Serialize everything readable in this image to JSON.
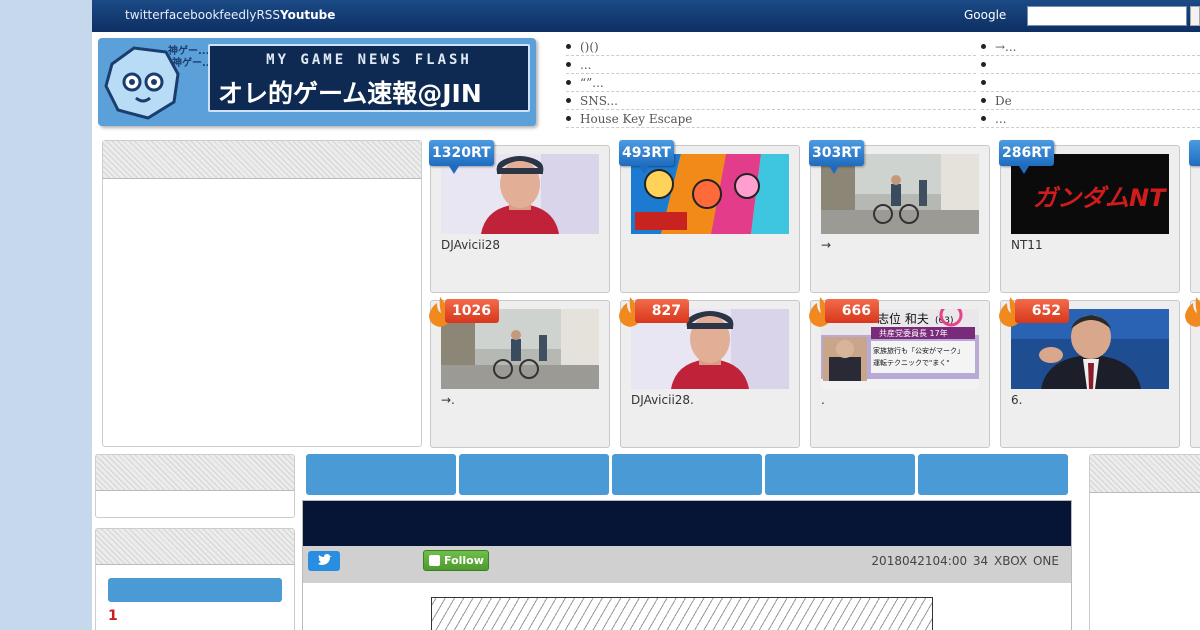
{
  "topbar": {
    "links": [
      "twitter",
      "facebook",
      "feedly",
      "RSS"
    ],
    "youtube": "Youtube",
    "search_label": "Google"
  },
  "logo": {
    "small_text_1": "神ゲー...",
    "small_text_2": "神ゲー...",
    "english": "MY GAME NEWS FLASH",
    "japanese": "オレ的ゲーム速報@JIN"
  },
  "header_links_left": [
    "()()",
    "...",
    "“”...",
    "SNS...",
    "House Key Escape"
  ],
  "header_links_right": [
    "→...",
    "",
    "",
    "De",
    "..."
  ],
  "rt_cards": [
    {
      "badge": "1320RT",
      "caption": "DJAvicii28",
      "thumb": "portrait-blue"
    },
    {
      "badge": "493RT",
      "caption": "",
      "thumb": "anime-colorful"
    },
    {
      "badge": "303RT",
      "caption": "→",
      "thumb": "street-bike"
    },
    {
      "badge": "286RT",
      "caption": "NT11",
      "thumb": "gundam-logo"
    }
  ],
  "hot_cards": [
    {
      "badge": "1026",
      "caption": "→.",
      "thumb": "street-bike"
    },
    {
      "badge": "827",
      "caption": "DJAvicii28.",
      "thumb": "portrait-blue"
    },
    {
      "badge": "666",
      "caption": ".",
      "thumb": "news-shii"
    },
    {
      "badge": "652",
      "caption": "6.",
      "thumb": "politician"
    }
  ],
  "news_thumb": {
    "name": "志位 和夫",
    "age": "(63)",
    "line1": "共産党委員長 17年",
    "line2": "家族旅行も「公安がマーク」",
    "line3": "運転テクニックで\"まく\""
  },
  "gundam_text": "ガンダムNT",
  "side": {
    "rank_number": "1"
  },
  "article": {
    "follow_label": "Follow",
    "date": "2018042104:00",
    "comments": "34",
    "category": "XBOX ONE"
  },
  "colors": {
    "topbar": "#0d2f63",
    "rt_badge": "#1f6cbf",
    "hot_badge": "#d8371c",
    "accent_blue": "#4a9ad6",
    "article_header": "#061535"
  }
}
